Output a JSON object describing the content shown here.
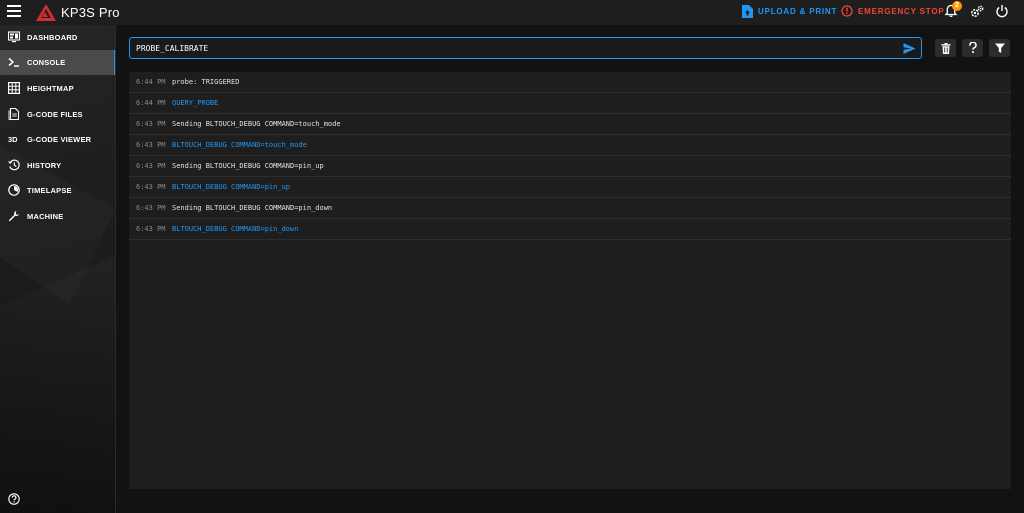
{
  "app": {
    "title": "KP3S Pro"
  },
  "topbar": {
    "upload_label": "UPLOAD & PRINT",
    "estop_label": "EMERGENCY STOP",
    "notification_count": "2"
  },
  "sidebar": {
    "items": [
      {
        "label": "DASHBOARD",
        "icon": "monitor-dashboard-icon"
      },
      {
        "label": "CONSOLE",
        "icon": "console-icon",
        "active": true
      },
      {
        "label": "HEIGHTMAP",
        "icon": "grid-icon"
      },
      {
        "label": "G-CODE FILES",
        "icon": "file-document-icon"
      },
      {
        "label": "G-CODE VIEWER",
        "icon": "3d-icon"
      },
      {
        "label": "HISTORY",
        "icon": "history-icon"
      },
      {
        "label": "TIMELAPSE",
        "icon": "timelapse-icon"
      },
      {
        "label": "MACHINE",
        "icon": "wrench-icon"
      }
    ]
  },
  "console": {
    "input_value": "PROBE_CALIBRATE",
    "logs": [
      {
        "time": "6:44 PM",
        "message": "probe: TRIGGERED",
        "type": "response"
      },
      {
        "time": "6:44 PM",
        "message": "QUERY_PROBE",
        "type": "command"
      },
      {
        "time": "6:43 PM",
        "message": "Sending BLTOUCH_DEBUG COMMAND=touch_mode",
        "type": "response"
      },
      {
        "time": "6:43 PM",
        "message": "BLTOUCH_DEBUG COMMAND=touch_mode",
        "type": "command"
      },
      {
        "time": "6:43 PM",
        "message": "Sending BLTOUCH_DEBUG COMMAND=pin_up",
        "type": "response"
      },
      {
        "time": "6:43 PM",
        "message": "BLTOUCH_DEBUG COMMAND=pin_up",
        "type": "command"
      },
      {
        "time": "6:43 PM",
        "message": "Sending BLTOUCH_DEBUG COMMAND=pin_down",
        "type": "response"
      },
      {
        "time": "6:43 PM",
        "message": "BLTOUCH_DEBUG COMMAND=pin_down",
        "type": "command"
      }
    ]
  },
  "colors": {
    "accent": "#2196f3",
    "danger": "#f44336",
    "badge": "#ff9800",
    "logo": "#d32f2f"
  }
}
